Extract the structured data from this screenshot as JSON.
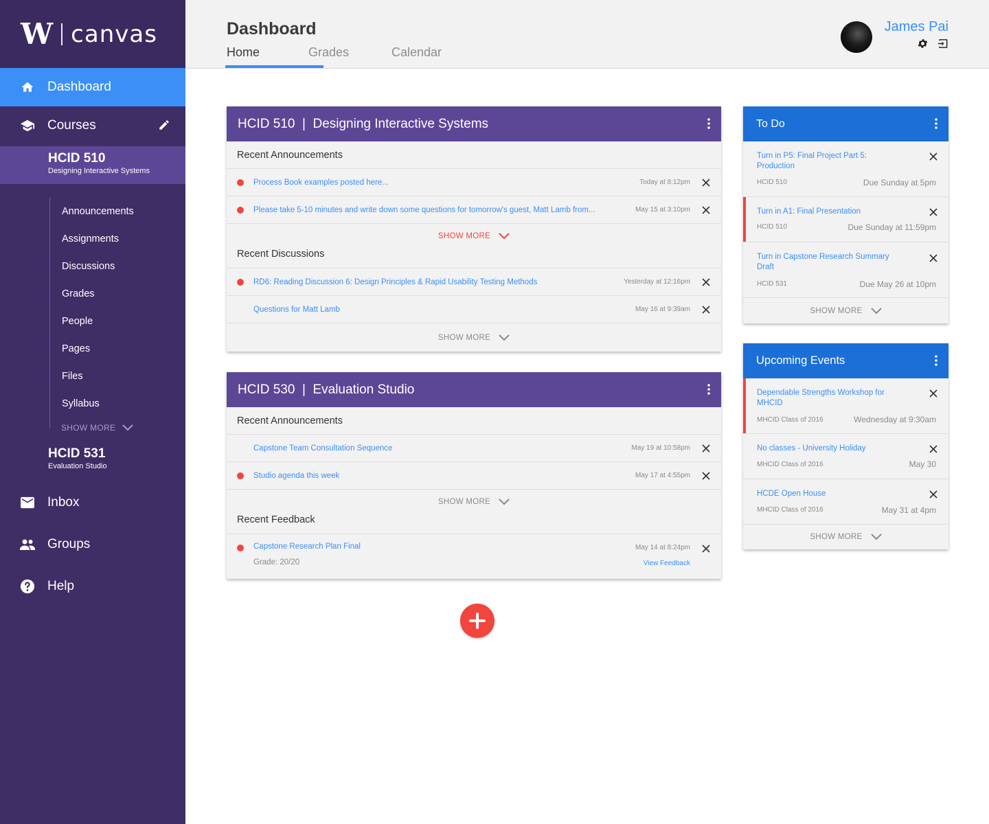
{
  "logo": {
    "mark": "W",
    "text": "canvas"
  },
  "sidebar": {
    "dashboard": "Dashboard",
    "courses": "Courses",
    "active_course": {
      "code": "HCID 510",
      "name": "Designing Interactive Systems"
    },
    "subnav": [
      "Announcements",
      "Assignments",
      "Discussions",
      "Grades",
      "People",
      "Pages",
      "Files",
      "Syllabus"
    ],
    "show_more": "SHOW MORE",
    "other_course": {
      "code": "HCID 531",
      "name": "Evaluation Studio"
    },
    "inbox": "Inbox",
    "groups": "Groups",
    "help": "Help"
  },
  "header": {
    "title": "Dashboard",
    "tabs": [
      "Home",
      "Grades",
      "Calendar"
    ],
    "user_name": "James Pai"
  },
  "card1": {
    "title": "HCID 510  |  Designing Interactive Systems",
    "announcements_title": "Recent Announcements",
    "announcements": [
      {
        "text": "Process Book examples posted here...",
        "time": "Today at 8:12pm"
      },
      {
        "text": "Please take 5-10 minutes and write down some questions for tomorrow's guest, Matt Lamb from...",
        "time": "May 15 at 3:10pm"
      }
    ],
    "show_more_1": "SHOW MORE",
    "discussions_title": "Recent Discussions",
    "discussions": [
      {
        "text": "RD6: Reading Discussion 6: Design Principles & Rapid Usability Testing Methods",
        "time": "Yesterday at 12:16pm"
      },
      {
        "text": "Questions for Matt Lamb",
        "time": "May 16 at 9:39am"
      }
    ],
    "show_more_2": "SHOW MORE"
  },
  "card2": {
    "title": "HCID 530  |  Evaluation Studio",
    "announcements_title": "Recent Announcements",
    "announcements": [
      {
        "text": "Capstone Team Consultation Sequence",
        "time": "May 19 at 10:58pm"
      },
      {
        "text": "Studio agenda this week",
        "time": "May 17 at 4:55pm"
      }
    ],
    "show_more_1": "SHOW MORE",
    "feedback_title": "Recent Feedback",
    "feedback": {
      "text": "Capstone Research Plan Final",
      "time": "May 14 at 8:24pm",
      "grade": "Grade:  20/20",
      "link": "View Feedback"
    }
  },
  "todo": {
    "title": "To Do",
    "items": [
      {
        "title": "Turn in P5: Final Project Part 5: Production",
        "course": "HCID 510",
        "due": "Due Sunday at 5pm"
      },
      {
        "title": "Turn in A1: Final Presentation",
        "course": "HCID 510",
        "due": "Due Sunday at 11:59pm"
      },
      {
        "title": "Turn in Capstone Research Summary Draft",
        "course": "HCID 531",
        "due": "Due May 26 at 10pm"
      }
    ],
    "show_more": "SHOW MORE"
  },
  "events": {
    "title": "Upcoming Events",
    "items": [
      {
        "title": "Dependable Strengths Workshop for MHCID",
        "group": "MHCID Class of 2016",
        "when": "Wednesday at 9:30am"
      },
      {
        "title": "No classes - University Holiday",
        "group": "MHCID Class of 2016",
        "when": "May 30"
      },
      {
        "title": "HCDE Open House",
        "group": "MHCID Class of 2016",
        "when": "May 31 at 4pm"
      }
    ],
    "show_more": "SHOW MORE"
  },
  "colors": {
    "purple_dark": "#3f2d66",
    "purple": "#5c4796",
    "blue": "#3b8ff7",
    "blue_dark": "#1b6fd7",
    "red": "#f2453d"
  },
  "icons": [
    "home-icon",
    "graduation-cap-icon",
    "pencil-icon",
    "mail-icon",
    "people-icon",
    "help-icon",
    "gear-icon",
    "logout-icon",
    "kebab-icon",
    "close-icon",
    "chevron-down-icon",
    "plus-icon"
  ]
}
